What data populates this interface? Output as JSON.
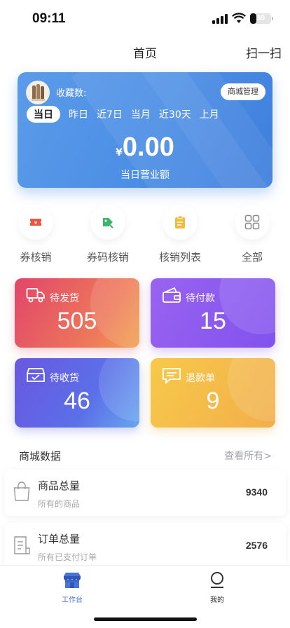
{
  "status_bar": {
    "time": "09:11",
    "battery": "30",
    "battery_level": 0.3
  },
  "nav": {
    "title": "首页",
    "scan": "扫一扫"
  },
  "banner": {
    "fav_label": "收藏数:",
    "shop_button": "商城管理",
    "tabs": [
      "当日",
      "昨日",
      "近7日",
      "当月",
      "近30天",
      "上月"
    ],
    "currency": "¥",
    "amount": "0.00",
    "amount_label": "当日营业额"
  },
  "quick_actions": [
    {
      "label": "券核销",
      "icon": "coupon-icon"
    },
    {
      "label": "券码核销",
      "icon": "code-tag-icon"
    },
    {
      "label": "核销列表",
      "icon": "clipboard-icon"
    },
    {
      "label": "全部",
      "icon": "grid-icon"
    }
  ],
  "stats": {
    "to_ship": {
      "title": "待发货",
      "value": "505",
      "icon": "truck-icon"
    },
    "to_pay": {
      "title": "待付款",
      "value": "15",
      "icon": "wallet-icon"
    },
    "to_receive": {
      "title": "待收货",
      "value": "46",
      "icon": "inbox-icon"
    },
    "refund": {
      "title": "退款单",
      "value": "9",
      "icon": "message-icon"
    }
  },
  "mall_data": {
    "title": "商城数据",
    "view_all": "查看所有>",
    "rows": [
      {
        "name": "商品总量",
        "sub": "所有的商品",
        "value": "9340",
        "icon": "bag-icon"
      },
      {
        "name": "订单总量",
        "sub": "所有已支付订单",
        "value": "2576",
        "icon": "receipt-icon"
      }
    ]
  },
  "tabbar": {
    "items": [
      {
        "label": "工作台",
        "icon": "store-icon"
      },
      {
        "label": "我的",
        "icon": "user-icon"
      }
    ]
  },
  "colors": {
    "accent": "#4d8fe6",
    "tab_active": "#4a73d6"
  }
}
